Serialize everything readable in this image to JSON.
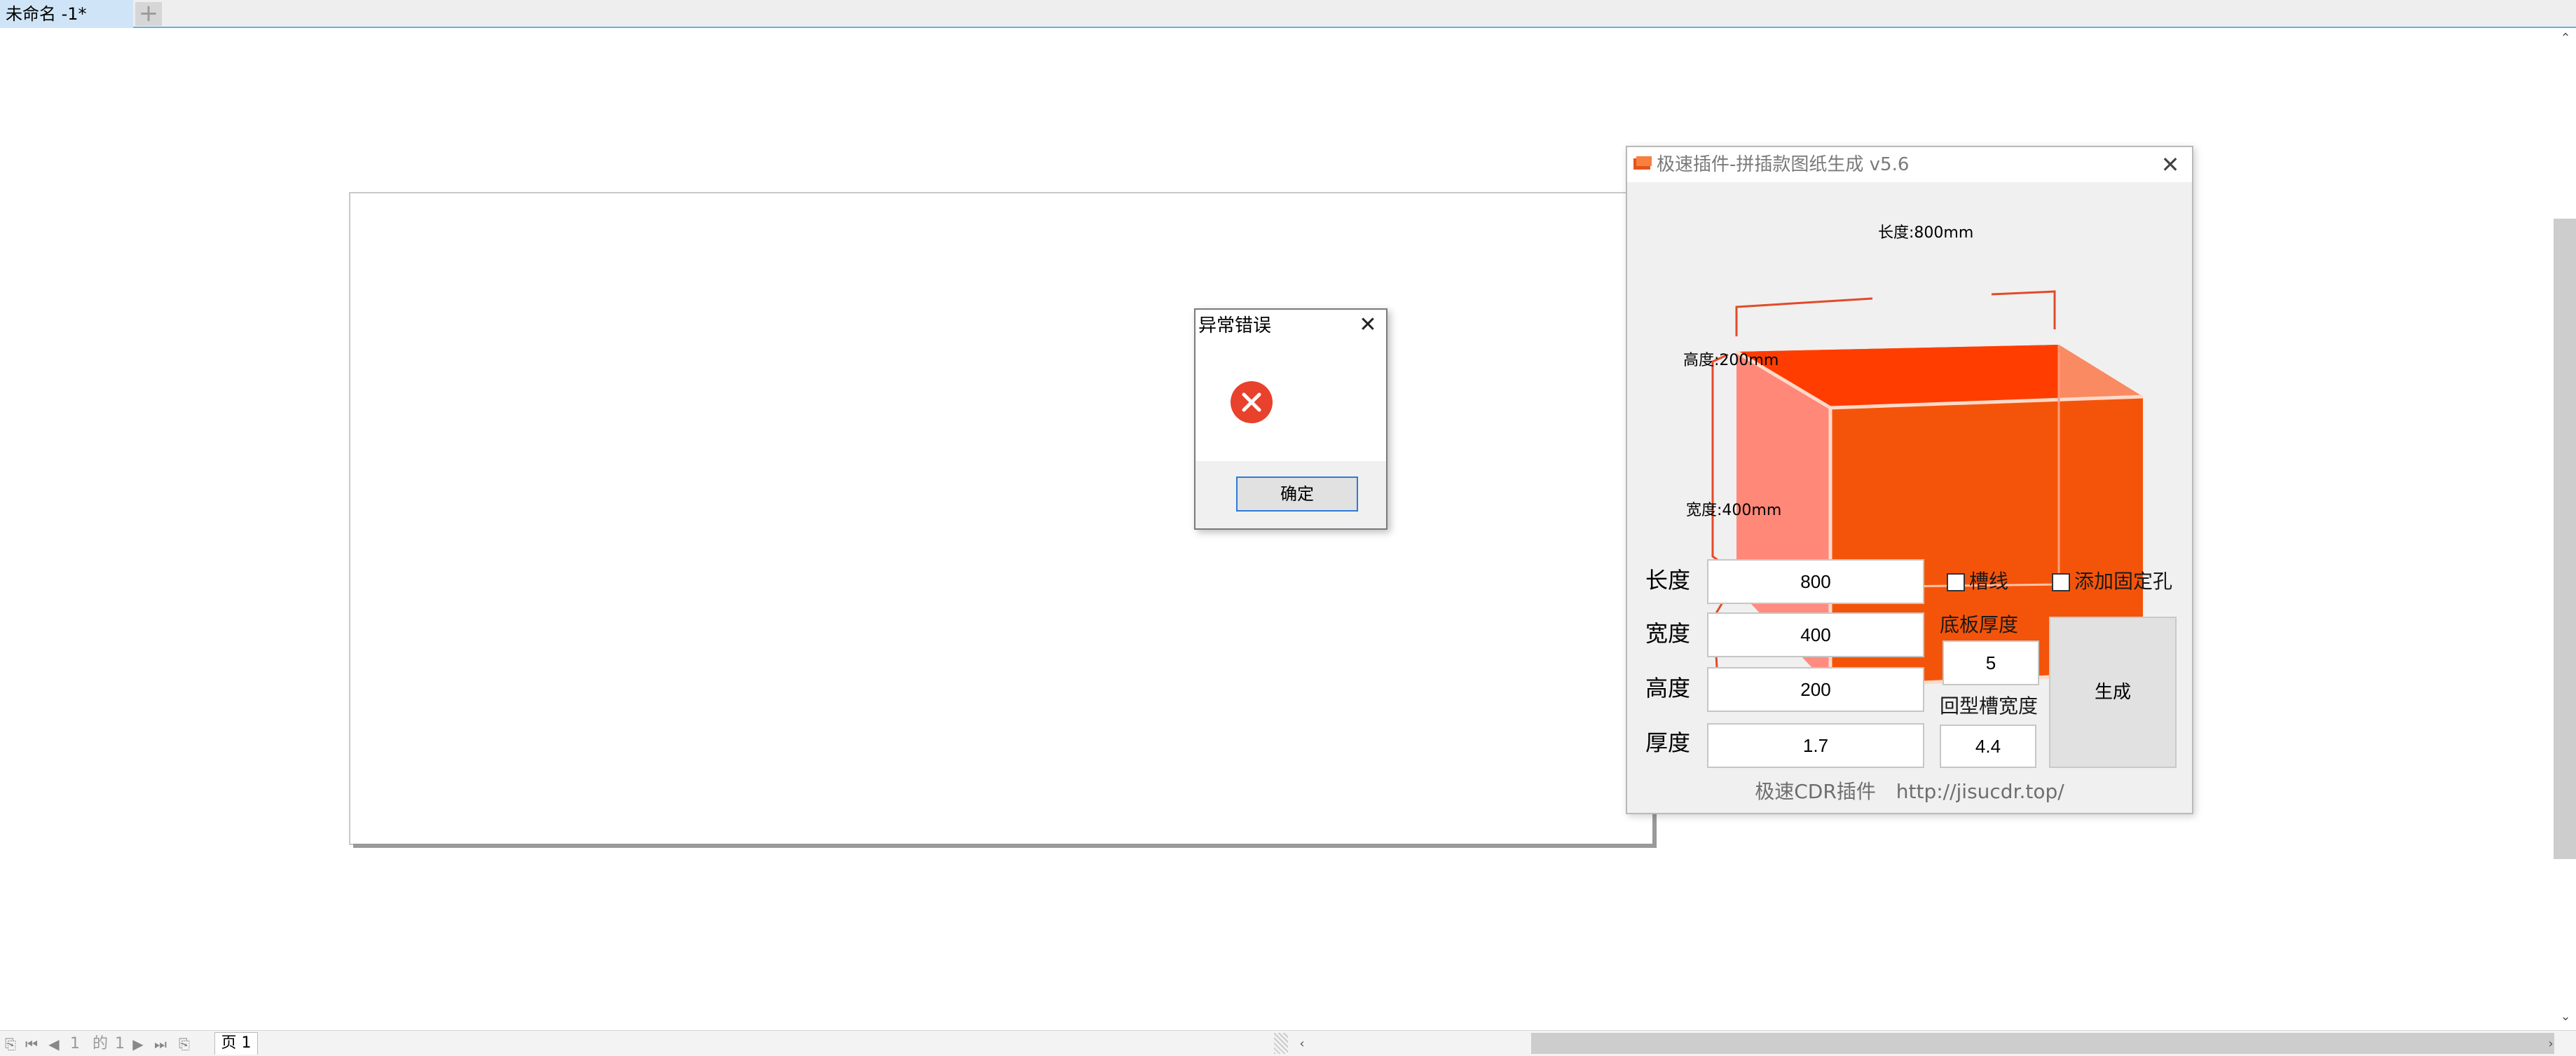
{
  "tabs": {
    "document": "未命名 -1*",
    "new_tab_glyph": "+"
  },
  "page_nav": {
    "current_page": "1",
    "of": "的",
    "total_pages": "1",
    "page_tab_label": "页 1"
  },
  "error_dialog": {
    "title": "异常错误",
    "close_glyph": "✕",
    "ok_label": "确定"
  },
  "plugin": {
    "title": "极速插件-拼插款图纸生成 v5.6",
    "close_glyph": "✕",
    "diagram": {
      "length_label": "长度:800mm",
      "height_label": "高度:200mm",
      "width_label": "宽度:400mm"
    },
    "fields": {
      "length_label": "长度",
      "length_value": "800",
      "width_label": "宽度",
      "width_value": "400",
      "height_label": "高度",
      "height_value": "200",
      "thickness_label": "厚度",
      "thickness_value": "1.7"
    },
    "options": {
      "groove_line_label": "槽线",
      "groove_line_checked": false,
      "add_fix_hole_label": "添加固定孔",
      "add_fix_hole_checked": false,
      "base_thickness_label": "底板厚度",
      "base_thickness_value": "5",
      "slot_width_label": "回型槽宽度",
      "slot_width_value": "4.4"
    },
    "generate_label": "生成",
    "footer_brand": "极速CDR插件",
    "footer_url": "http://jisucdr.top/"
  },
  "colors": {
    "accent": "#5fb3e3",
    "error_red": "#e8412c",
    "box_orange": "#f4501a"
  }
}
